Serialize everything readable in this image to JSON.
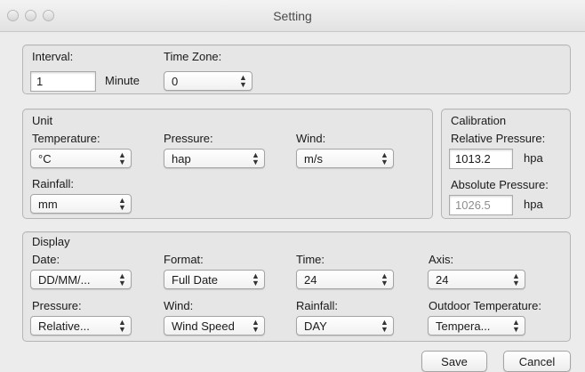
{
  "window": {
    "title": "Setting"
  },
  "general": {
    "interval_label": "Interval:",
    "interval_value": "1",
    "interval_unit": "Minute",
    "timezone_label": "Time Zone:",
    "timezone_value": "0"
  },
  "unit": {
    "group_label": "Unit",
    "temperature_label": "Temperature:",
    "temperature_value": "°C",
    "pressure_label": "Pressure:",
    "pressure_value": "hap",
    "wind_label": "Wind:",
    "wind_value": "m/s",
    "rainfall_label": "Rainfall:",
    "rainfall_value": "mm"
  },
  "calibration": {
    "group_label": "Calibration",
    "relative_label": "Relative Pressure:",
    "relative_value": "1013.2",
    "relative_unit": "hpa",
    "absolute_label": "Absolute Pressure:",
    "absolute_value": "1026.5",
    "absolute_unit": "hpa"
  },
  "display": {
    "group_label": "Display",
    "date_label": "Date:",
    "date_value": "DD/MM/...",
    "format_label": "Format:",
    "format_value": "Full Date",
    "time_label": "Time:",
    "time_value": "24",
    "axis_label": "Axis:",
    "axis_value": "24",
    "pressure_label": "Pressure:",
    "pressure_value": "Relative...",
    "wind_label": "Wind:",
    "wind_value": "Wind Speed",
    "rainfall_label": "Rainfall:",
    "rainfall_value": "DAY",
    "outdoor_temp_label": "Outdoor Temperature:",
    "outdoor_temp_value": "Tempera..."
  },
  "actions": {
    "save_label": "Save",
    "cancel_label": "Cancel"
  }
}
